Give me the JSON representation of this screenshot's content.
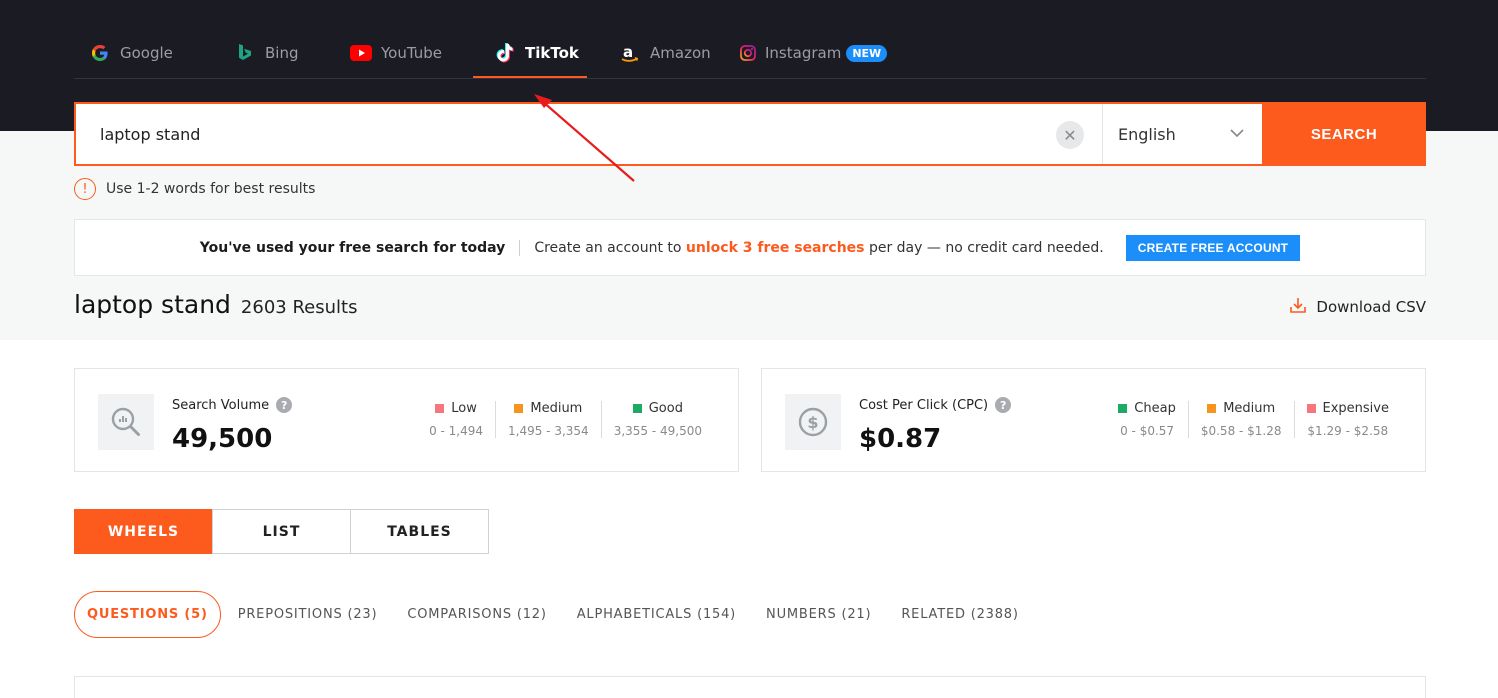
{
  "engines": [
    {
      "id": "google",
      "label": "Google"
    },
    {
      "id": "bing",
      "label": "Bing"
    },
    {
      "id": "youtube",
      "label": "YouTube"
    },
    {
      "id": "tiktok",
      "label": "TikTok"
    },
    {
      "id": "amazon",
      "label": "Amazon"
    },
    {
      "id": "instagram",
      "label": "Instagram",
      "badge": "NEW"
    }
  ],
  "active_engine": "tiktok",
  "search": {
    "value": "laptop stand",
    "language": "English",
    "button_label": "SEARCH",
    "clear_icon": "close-icon"
  },
  "tip": "Use 1-2 words for best results",
  "notice": {
    "lead": "You've used your free search for today",
    "text_before": "Create an account to",
    "highlight": "unlock 3 free searches",
    "text_after": "per day — no credit card needed.",
    "button_label": "CREATE FREE ACCOUNT"
  },
  "results": {
    "keyword": "laptop stand",
    "count": "2603 Results",
    "download_label": "Download CSV"
  },
  "metrics": {
    "volume": {
      "label": "Search Volume",
      "value": "49,500",
      "legend": [
        {
          "name": "Low",
          "range": "0 - 1,494",
          "color": "#f6767d"
        },
        {
          "name": "Medium",
          "range": "1,495 - 3,354",
          "color": "#f7941d"
        },
        {
          "name": "Good",
          "range": "3,355 - 49,500",
          "color": "#1faa64"
        }
      ]
    },
    "cpc": {
      "label": "Cost Per Click (CPC)",
      "value": "$0.87",
      "legend": [
        {
          "name": "Cheap",
          "range": "0 - $0.57",
          "color": "#1faa64"
        },
        {
          "name": "Medium",
          "range": "$0.58 - $1.28",
          "color": "#f7941d"
        },
        {
          "name": "Expensive",
          "range": "$1.29 - $2.58",
          "color": "#f6767d"
        }
      ]
    }
  },
  "view_tabs": [
    "WHEELS",
    "LIST",
    "TABLES"
  ],
  "active_view": "WHEELS",
  "categories": [
    "QUESTIONS (5)",
    "PREPOSITIONS (23)",
    "COMPARISONS (12)",
    "ALPHABETICALS (154)",
    "NUMBERS (21)",
    "RELATED (2388)"
  ],
  "active_category": "QUESTIONS (5)",
  "colors": {
    "accent": "#fd5a1e",
    "blue": "#1c8ef9",
    "header_bg": "#1b1b24"
  }
}
